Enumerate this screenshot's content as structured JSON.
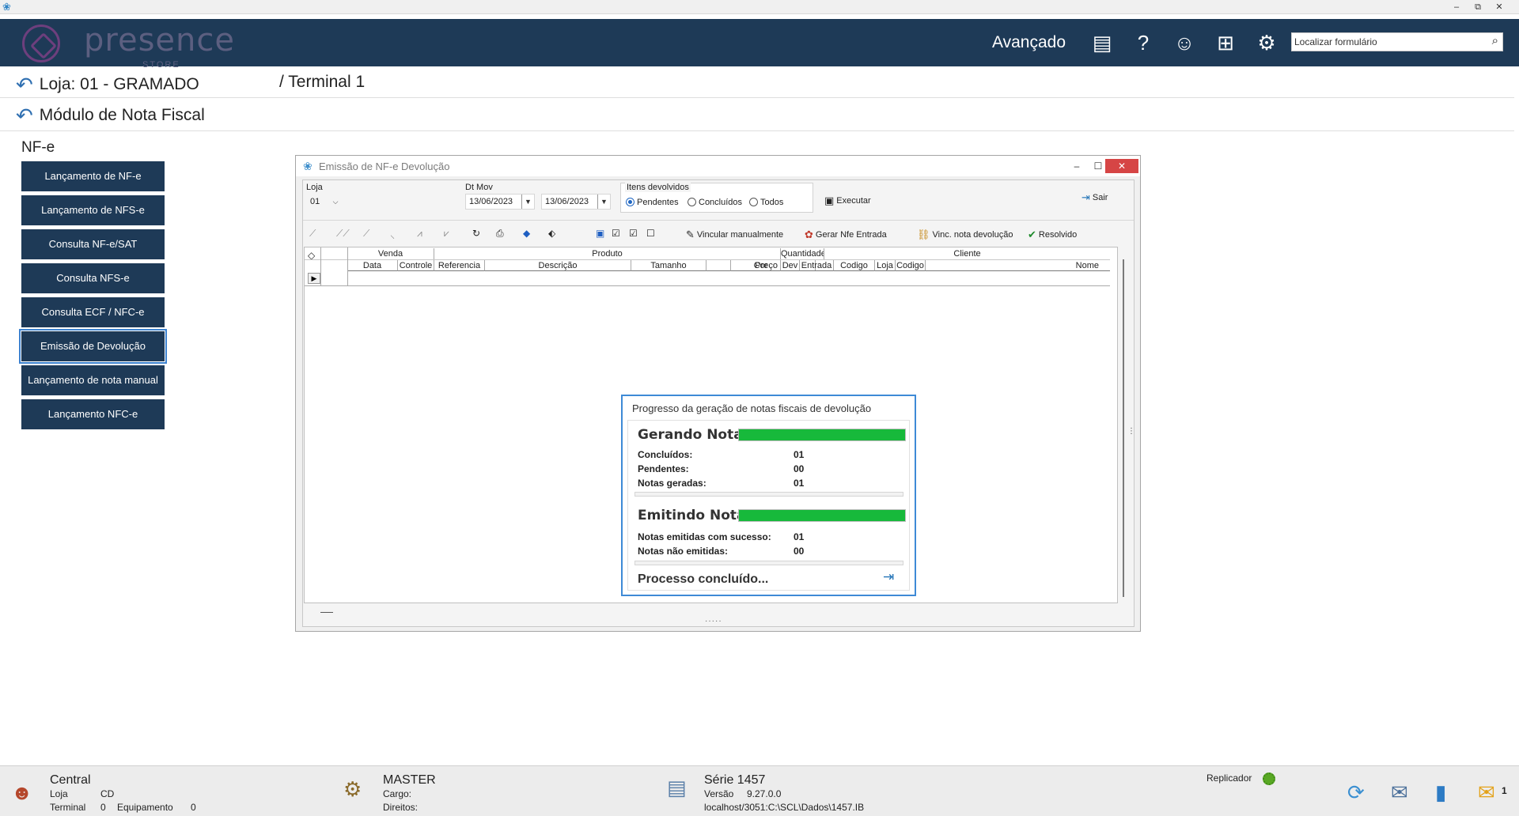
{
  "os": {
    "app_icon": "app-logo-icon",
    "minimize": "–",
    "restore": "⧉",
    "close": "✕"
  },
  "brand": {
    "name": "presence",
    "sub": "STORE",
    "mode": "Avançado"
  },
  "top_icons": [
    "news-icon",
    "help-icon",
    "users-icon",
    "network-icon",
    "settings-icon"
  ],
  "search": {
    "placeholder": "Localizar formulário",
    "value": ""
  },
  "breadcrumb": {
    "loja": "Loja: 01 - GRAMADO",
    "terminal": "/ Terminal 1",
    "module": "Módulo de Nota Fiscal"
  },
  "section": "NF-e",
  "menu": [
    {
      "label": "Lançamento de NF-e",
      "active": false
    },
    {
      "label": "Lançamento de NFS-e",
      "active": false
    },
    {
      "label": "Consulta NF-e/SAT",
      "active": false
    },
    {
      "label": "Consulta NFS-e",
      "active": false
    },
    {
      "label": "Consulta ECF / NFC-e",
      "active": false
    },
    {
      "label": "Emissão de Devolução",
      "active": true
    },
    {
      "label": "Lançamento de nota manual",
      "active": false
    },
    {
      "label": "Lançamento NFC-e",
      "active": false
    }
  ],
  "window": {
    "title": "Emissão de NF-e Devolução",
    "controls": {
      "minimize": "–",
      "maximize": "☐",
      "close": "✕"
    },
    "loja_label": "Loja",
    "loja_value": "01",
    "dtmov_label": "Dt Mov",
    "date_from": "13/06/2023",
    "date_to": "13/06/2023",
    "itens_label": "Itens devolvidos",
    "radios": [
      {
        "label": "Pendentes",
        "checked": true
      },
      {
        "label": "Concluídos",
        "checked": false
      },
      {
        "label": "Todos",
        "checked": false
      }
    ],
    "executar": "Executar",
    "sair": "Sair",
    "toolbar": {
      "vincular": "Vincular manualmente",
      "gerar": "Gerar Nfe Entrada",
      "vinc_nota": "Vinc. nota devolução",
      "resolvido": "Resolvido"
    },
    "grid": {
      "groups": {
        "venda": "Venda",
        "produto": "Produto",
        "quantidade": "Quantidade",
        "cliente": "Cliente"
      },
      "columns": [
        "Data",
        "Controle",
        "Referencia",
        "Descrição",
        "Tamanho",
        "Cor",
        "Preço",
        "Dev",
        "Entrada",
        "Codigo",
        "Loja",
        "Codigo",
        "Nome"
      ],
      "rows": []
    }
  },
  "progress": {
    "title": "Progresso da geração de notas fiscais de devolução",
    "gerando": {
      "heading": "Gerando Notas",
      "progress": 1.0,
      "concluidos_label": "Concluídos:",
      "concluidos": "01",
      "pendentes_label": "Pendentes:",
      "pendentes": "00",
      "geradas_label": "Notas geradas:",
      "geradas": "01"
    },
    "emitindo": {
      "heading": "Emitindo Notas",
      "progress": 1.0,
      "sucesso_label": "Notas emitidas com sucesso:",
      "sucesso": "01",
      "nao_label": "Notas não emitidas:",
      "nao": "00"
    },
    "status": "Processo concluído..."
  },
  "status": {
    "central": "Central",
    "loja_label": "Loja",
    "loja": "CD",
    "terminal_label": "Terminal",
    "terminal": "0",
    "equip_label": "Equipamento",
    "equip": "0",
    "user": "MASTER",
    "cargo": "Cargo:",
    "direitos": "Direitos:",
    "serie": "Série   1457",
    "versao_label": "Versão",
    "versao": "9.27.0.0",
    "db": "localhost/3051:C:\\SCL\\Dados\\1457.IB",
    "replicador": "Replicador",
    "notif_count": "1"
  }
}
